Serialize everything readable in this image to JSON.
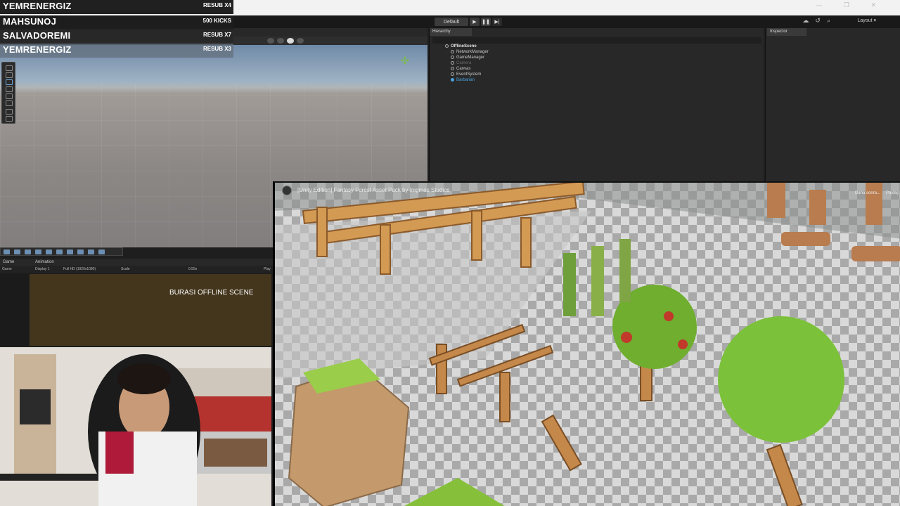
{
  "overlay": {
    "rows": [
      {
        "name": "YEMRENERGIZ",
        "value": "RESUB X4"
      },
      {
        "name": "MAHSUNOJ",
        "value": "500 KICKS"
      },
      {
        "name": "SALVADOREMI",
        "value": "RESUB X7"
      },
      {
        "name": "YEMRENERGIZ",
        "value": "RESUB X3"
      }
    ]
  },
  "toolbar": {
    "layout_label": "Default",
    "layout_dropdown": "Layout"
  },
  "hierarchy": {
    "tab_label": "Hierarchy",
    "items": [
      {
        "label": "OfflineScene",
        "style": "bold"
      },
      {
        "label": "NetworkManager",
        "style": "normal"
      },
      {
        "label": "GameManager",
        "style": "normal"
      },
      {
        "label": "Camera",
        "style": "dim"
      },
      {
        "label": "Canvas",
        "style": "normal"
      },
      {
        "label": "EventSystem",
        "style": "normal"
      },
      {
        "label": "Barbarian",
        "style": "sel"
      }
    ]
  },
  "inspector": {
    "tab_label": "Inspector"
  },
  "game": {
    "tab_game": "Game",
    "tab_animation": "Animation",
    "bar_game": "Game",
    "bar_display": "Display 1",
    "bar_resolution": "Full HD (1920x1080)",
    "bar_scale": "Scale",
    "bar_scale_value": "0.55x",
    "bar_play": "Play",
    "scene_text": "BURASI OFFLINE SCENE"
  },
  "video": {
    "title": "[Unity Edition] Fantasy Forest Asset Pack by Inigmas Studios",
    "side_label_1": "Daha sonra...",
    "side_label_2": "Paylaş"
  },
  "colors": {
    "game_bg": "#44361d",
    "selection_blue": "#4aa3e0",
    "unity_dark": "#282828"
  }
}
